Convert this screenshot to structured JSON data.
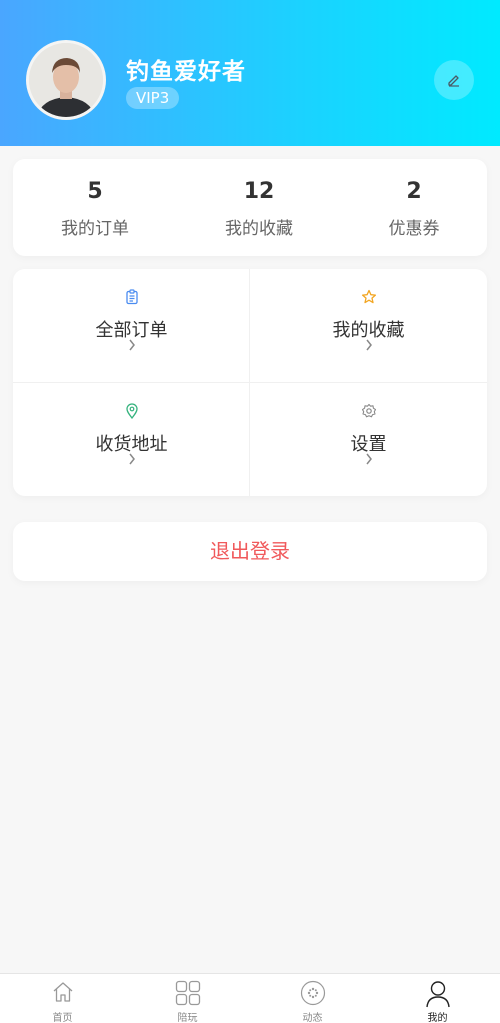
{
  "profile": {
    "name": "钓鱼爱好者",
    "vip": "VIP3"
  },
  "stats": [
    {
      "value": "5",
      "label": "我的订单"
    },
    {
      "value": "12",
      "label": "我的收藏"
    },
    {
      "value": "2",
      "label": "优惠券"
    }
  ],
  "menu": [
    {
      "label": "全部订单",
      "icon": "clipboard-icon",
      "color": "#4a8cf0"
    },
    {
      "label": "我的收藏",
      "icon": "star-icon",
      "color": "#f2a623"
    },
    {
      "label": "收货地址",
      "icon": "location-pin-icon",
      "color": "#36b37e"
    },
    {
      "label": "设置",
      "icon": "gear-icon",
      "color": "#888888"
    }
  ],
  "logout": {
    "label": "退出登录",
    "color": "#f0595b"
  },
  "tabbar": [
    {
      "label": "首页",
      "icon": "home-icon"
    },
    {
      "label": "陪玩",
      "icon": "grid-icon"
    },
    {
      "label": "动态",
      "icon": "circle-dots-icon"
    },
    {
      "label": "我的",
      "icon": "user-icon",
      "active": true
    }
  ]
}
